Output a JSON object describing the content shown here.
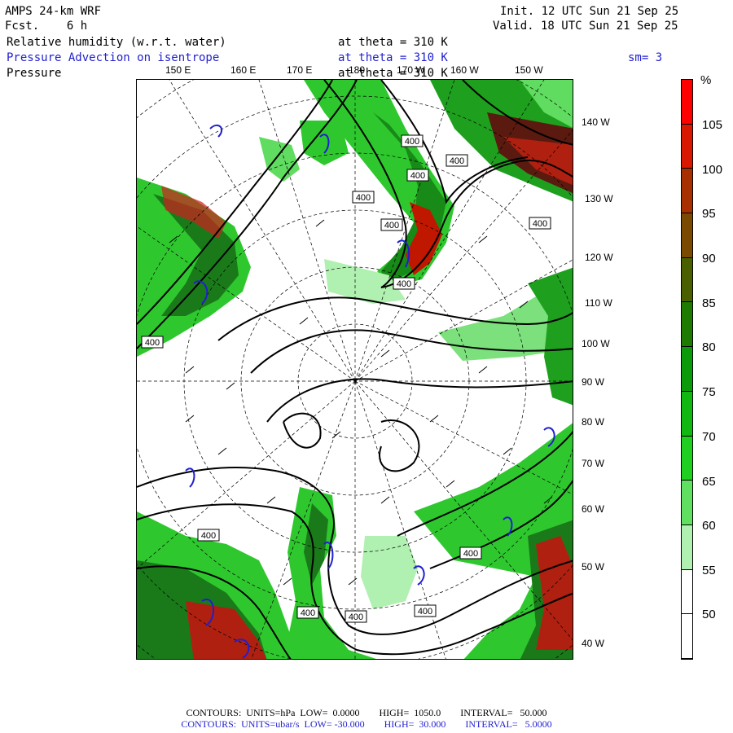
{
  "header": {
    "model": "AMPS 24-km WRF",
    "fcst": "Fcst.    6 h",
    "init": "Init. 12 UTC Sun 21 Sep 25",
    "valid": "Valid. 18 UTC Sun 21 Sep 25"
  },
  "fields": [
    {
      "name": "Relative humidity (w.r.t. water)",
      "level": "at theta = 310 K",
      "color": "#000000"
    },
    {
      "name": "Pressure Advection on isentrope",
      "level": "at theta = 310 K",
      "color": "#1f1fd0"
    },
    {
      "name": "Pressure",
      "level": "at theta = 310 K",
      "color": "#000000"
    }
  ],
  "smoothing": "sm= 3",
  "top_lon_labels": [
    "150 E",
    "160 E",
    "170 E",
    "180",
    "170 W",
    "160 W",
    "150 W"
  ],
  "right_lon_labels": [
    "140 W",
    "130 W",
    "120 W",
    "110 W",
    "100 W",
    "90 W",
    "80 W",
    "70 W",
    "60 W",
    "50 W",
    "40 W"
  ],
  "contour_labels": [
    "400",
    "400",
    "400",
    "400",
    "400",
    "400",
    "400",
    "400",
    "400",
    "400",
    "400",
    "400",
    "400"
  ],
  "colorbar": {
    "unit": "%",
    "labels": [
      "105",
      "100",
      "95",
      "90",
      "85",
      "80",
      "75",
      "70",
      "65",
      "60",
      "55",
      "50"
    ],
    "colors": [
      "#ff0000",
      "#d81800",
      "#a83000",
      "#7a4a00",
      "#4a6000",
      "#1e7a00",
      "#0a9a0a",
      "#10b810",
      "#20d020",
      "#60e060",
      "#b0f0b0",
      "#ffffff",
      "#ffffff"
    ]
  },
  "footer": {
    "line1": "CONTOURS:  UNITS=hPa  LOW=  0.0000        HIGH=  1050.0        INTERVAL=   50.000",
    "line2": "CONTOURS:  UNITS=ubar/s  LOW= -30.000        HIGH=  30.000        INTERVAL=   5.0000"
  }
}
